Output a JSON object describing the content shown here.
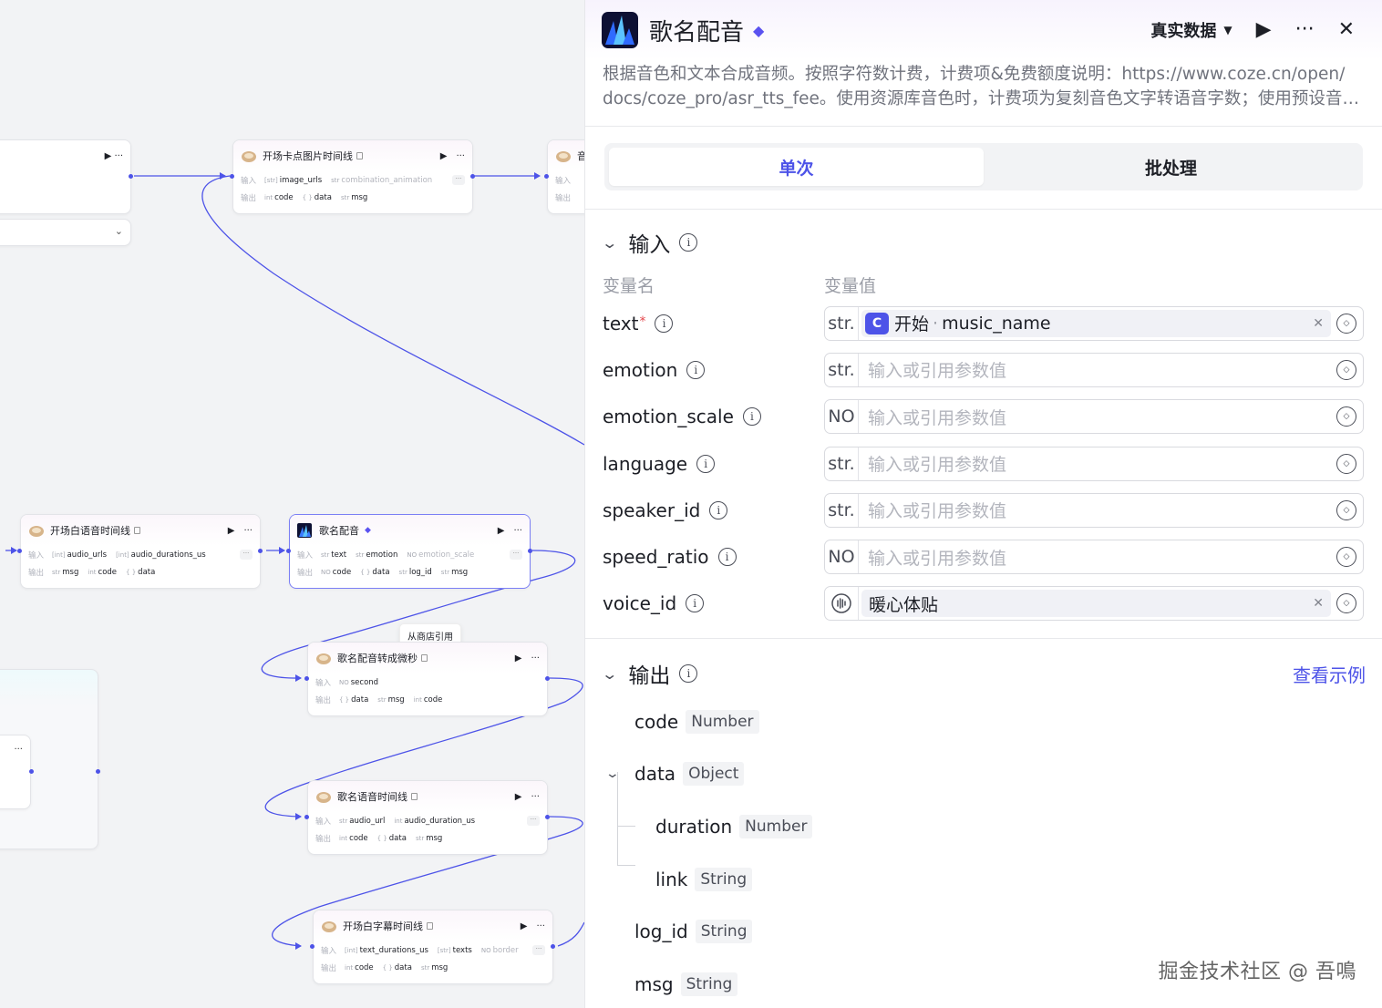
{
  "canvas": {
    "nodes": [
      {
        "id": "partial-left-top",
        "title": "",
        "actions": "▶ ···"
      },
      {
        "id": "opening-image-timeline",
        "title": "开场卡点图片时间线",
        "inputs_label": "输入",
        "outputs_label": "输出",
        "inputs": [
          {
            "t": "[str]",
            "n": "image_urls"
          },
          {
            "t": "str",
            "n": "combination_animation",
            "fade": true
          }
        ],
        "outputs": [
          {
            "t": "int",
            "n": "code"
          },
          {
            "t": "{ }",
            "n": "data"
          },
          {
            "t": "str",
            "n": "msg"
          }
        ]
      },
      {
        "id": "partial-right-top",
        "title": "音"
      },
      {
        "id": "opening-voice-timeline",
        "title": "开场白语音时间线",
        "inputs_label": "输入",
        "outputs_label": "输出",
        "inputs": [
          {
            "t": "[int]",
            "n": "audio_urls"
          },
          {
            "t": "[int]",
            "n": "audio_durations_us"
          }
        ],
        "outputs": [
          {
            "t": "str",
            "n": "msg"
          },
          {
            "t": "int",
            "n": "code"
          },
          {
            "t": "{ }",
            "n": "data"
          }
        ]
      },
      {
        "id": "song-dubbing",
        "title": "歌名配音",
        "inputs_label": "输入",
        "outputs_label": "输出",
        "inputs": [
          {
            "t": "str",
            "n": "text"
          },
          {
            "t": "str",
            "n": "emotion"
          },
          {
            "t": "NO",
            "n": "emotion_scale",
            "fade": true
          }
        ],
        "outputs": [
          {
            "t": "NO",
            "n": "code"
          },
          {
            "t": "{ }",
            "n": "data"
          },
          {
            "t": "str",
            "n": "log_id"
          },
          {
            "t": "str",
            "n": "msg"
          }
        ]
      },
      {
        "id": "song-dubbing-to-us",
        "title": "歌名配音转成微秒",
        "inputs_label": "输入",
        "outputs_label": "输出",
        "inputs": [
          {
            "t": "NO",
            "n": "second"
          }
        ],
        "outputs": [
          {
            "t": "{ }",
            "n": "data"
          },
          {
            "t": "str",
            "n": "msg"
          },
          {
            "t": "int",
            "n": "code"
          }
        ]
      },
      {
        "id": "song-voice-timeline",
        "title": "歌名语音时间线",
        "inputs_label": "输入",
        "outputs_label": "输出",
        "inputs": [
          {
            "t": "str",
            "n": "audio_url"
          },
          {
            "t": "int",
            "n": "audio_duration_us"
          }
        ],
        "outputs": [
          {
            "t": "int",
            "n": "code"
          },
          {
            "t": "{ }",
            "n": "data"
          },
          {
            "t": "str",
            "n": "msg"
          }
        ]
      },
      {
        "id": "opening-subtitle-timeline",
        "title": "开场白字幕时间线",
        "inputs_label": "输入",
        "outputs_label": "输出",
        "inputs": [
          {
            "t": "[int]",
            "n": "text_durations_us"
          },
          {
            "t": "[str]",
            "n": "texts"
          },
          {
            "t": "NO",
            "n": "border",
            "fade": true
          }
        ],
        "outputs": [
          {
            "t": "int",
            "n": "code"
          },
          {
            "t": "{ }",
            "n": "data"
          },
          {
            "t": "str",
            "n": "msg"
          }
        ]
      }
    ],
    "tooltip": "从商店引用",
    "partial_bottom_actions": "···"
  },
  "panel": {
    "title": "歌名配音",
    "data_mode": "真实数据",
    "description_line1": "根据音色和文本合成音频。按照字符数计费，计费项&免费额度说明：https://www.coze.cn/open/",
    "description_line2": "docs/coze_pro/asr_tts_fee。使用资源库音色时，计费项为复刻音色文字转语音字数；使用预设音色时，",
    "tabs": [
      "单次",
      "批处理"
    ],
    "input_section": "输入",
    "col_name": "变量名",
    "col_value": "变量值",
    "placeholder": "输入或引用参数值",
    "params": [
      {
        "name": "text",
        "required": true,
        "type": "str.",
        "ref_node": "开始",
        "ref_var": "music_name"
      },
      {
        "name": "emotion",
        "type": "str."
      },
      {
        "name": "emotion_scale",
        "type": "NO"
      },
      {
        "name": "language",
        "type": "str."
      },
      {
        "name": "speaker_id",
        "type": "str."
      },
      {
        "name": "speed_ratio",
        "type": "NO"
      },
      {
        "name": "voice_id",
        "voice": "暖心体贴"
      }
    ],
    "output_section": "输出",
    "view_example": "查看示例",
    "outputs": [
      {
        "name": "code",
        "type": "Number"
      },
      {
        "name": "data",
        "type": "Object"
      },
      {
        "name": "duration",
        "type": "Number"
      },
      {
        "name": "link",
        "type": "String"
      },
      {
        "name": "log_id",
        "type": "String"
      },
      {
        "name": "msg",
        "type": "String"
      }
    ]
  },
  "watermark": "掘金技术社区 @ 吾鳴",
  "colors": {
    "accent": "#4d53e8",
    "wire": "#4d53e8",
    "required": "#e5484d"
  }
}
